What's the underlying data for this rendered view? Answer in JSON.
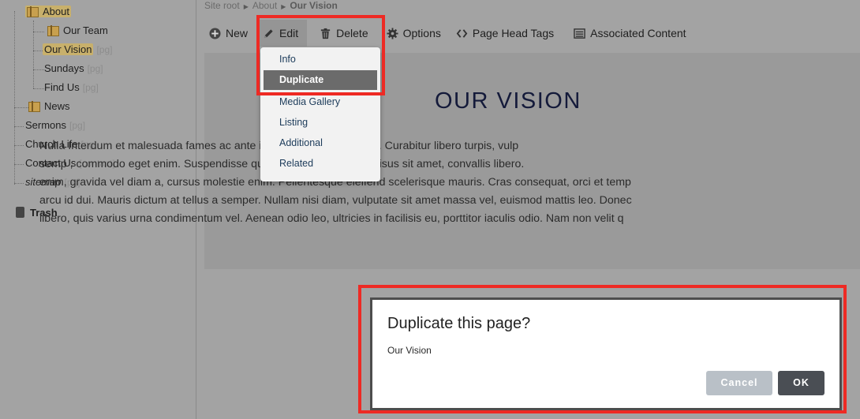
{
  "sidebar": {
    "tree": [
      {
        "label": "About",
        "suffix": ""
      },
      {
        "label": "Our Team",
        "suffix": ""
      },
      {
        "label": "Our Vision",
        "suffix": "[pg]"
      },
      {
        "label": "Sundays",
        "suffix": "[pg]"
      },
      {
        "label": "Find Us",
        "suffix": "[pg]"
      },
      {
        "label": "News",
        "suffix": ""
      },
      {
        "label": "Sermons",
        "suffix": "[pg]"
      },
      {
        "label": "Church Life",
        "suffix": "[pg]"
      },
      {
        "label": "Contact Us",
        "suffix": "[contact]"
      },
      {
        "label": "sitemap",
        "suffix": "[pg]"
      }
    ],
    "trash_label": "Trash"
  },
  "breadcrumb": [
    "Site root",
    "About",
    "Our Vision"
  ],
  "toolbar": {
    "new": "New",
    "edit": "Edit",
    "delete": "Delete",
    "options": "Options",
    "page_head_tags": "Page Head Tags",
    "associated_content": "Associated Content"
  },
  "edit_menu": {
    "items": [
      "Info",
      "Duplicate",
      "Media Gallery",
      "Listing",
      "Additional",
      "Related"
    ],
    "selected": "Duplicate"
  },
  "page": {
    "heading": "OUR VISION",
    "body_lines": [
      "Nulla                          Interdum et malesuada fames ac ante ipsum primis in faucibus. Curabitur libero turpis, vulp",
      "semp                          , commodo eget enim. Suspendisse quis odio tincidunt, porta risus sit amet, convallis libero.",
      "enim, gravida vel diam a, cursus molestie enim. Pellentesque eleifend scelerisque mauris. Cras consequat, orci et temp",
      "arcu id dui. Mauris dictum at tellus a semper. Nullam nisi diam, vulputate sit amet massa vel, euismod mattis leo. Donec",
      "libero, quis varius urna condimentum vel. Aenean odio leo, ultricies in facilisis eu, porttitor iaculis odio. Nam non velit q"
    ]
  },
  "dialog": {
    "title": "Duplicate this page?",
    "subtitle": "Our Vision",
    "cancel_label": "Cancel",
    "ok_label": "OK"
  },
  "colors": {
    "highlight_box": "#ee2a24",
    "menu_selected": "#6b6b6b",
    "ok_button": "#4a4e54",
    "cancel_button": "#b9c0c7"
  }
}
